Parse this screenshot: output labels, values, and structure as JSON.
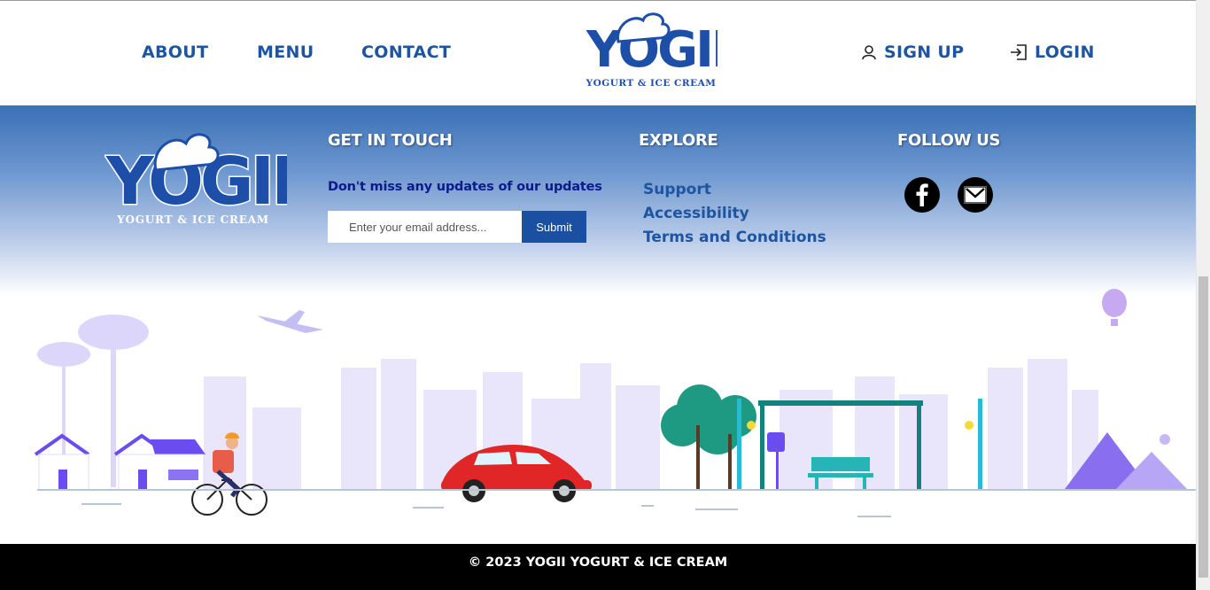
{
  "nav": {
    "about": "ABOUT",
    "menu": "MENU",
    "contact": "CONTACT",
    "sign_up": "SIGN UP",
    "login": "LOGIN"
  },
  "brand": {
    "name": "YOGII",
    "tagline": "YOGURT & ICE CREAM"
  },
  "footer": {
    "get_in_touch": {
      "heading": "GET IN TOUCH",
      "text": "Don't miss any updates of our updates",
      "email_placeholder": "Enter your email address...",
      "submit_label": "Submit"
    },
    "explore": {
      "heading": "EXPLORE",
      "links": [
        "Support",
        "Accessibility",
        "Terms and Conditions"
      ]
    },
    "follow": {
      "heading": "FOLLOW US",
      "icons": [
        "facebook-icon",
        "mail-icon"
      ]
    }
  },
  "copyright": "© 2023 YOGII YOGURT & ICE CREAM",
  "colors": {
    "brand_blue": "#1e55a0",
    "dark_navy": "#0b1c8a",
    "button_blue": "#1a4fa2",
    "footer_bar": "#000000"
  }
}
